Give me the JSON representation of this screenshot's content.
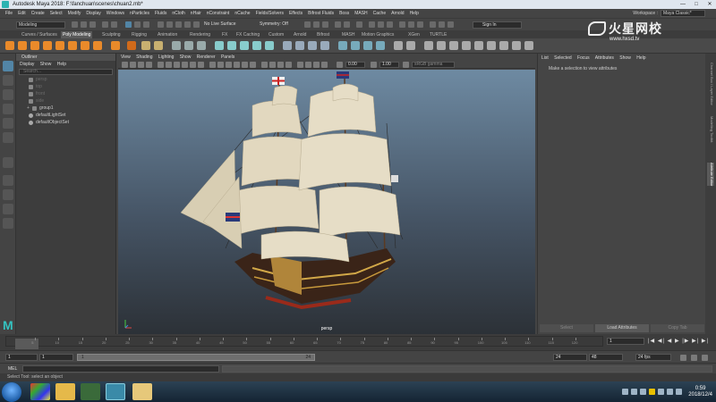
{
  "window": {
    "title": "Autodesk Maya 2018: F:\\fanchuan\\scenes\\chuan2.mb*",
    "controls": [
      "—",
      "□",
      "✕"
    ]
  },
  "menubar": {
    "items": [
      "File",
      "Edit",
      "Create",
      "Select",
      "Modify",
      "Display",
      "Windows",
      "nParticles",
      "Fluids",
      "nCloth",
      "nHair",
      "nConstraint",
      "nCache",
      "Fields/Solvers",
      "Effects",
      "Bifrost Fluids",
      "Boss",
      "MASH",
      "Cache",
      "Arnold",
      "Help"
    ],
    "workspace_label": "Workspace :",
    "workspace_value": "Maya Classic*"
  },
  "statusline": {
    "mode": "Modeling",
    "live_surface": "No Live Surface",
    "symmetry": "Symmetry: Off",
    "sign_in": "Sign In"
  },
  "shelf": {
    "tabs": [
      "Curves / Surfaces",
      "Poly Modeling",
      "Sculpting",
      "Rigging",
      "Animation",
      "Rendering",
      "FX",
      "FX Caching",
      "Custom",
      "Arnold",
      "Bifrost",
      "MASH",
      "Motion Graphics",
      "XGen",
      "TURTLE"
    ],
    "active_tab": "Poly Modeling"
  },
  "outliner": {
    "title": "Outliner",
    "menus": [
      "Display",
      "Show",
      "Help"
    ],
    "search_placeholder": "Search...",
    "items": [
      {
        "label": "persp",
        "dim": true
      },
      {
        "label": "top",
        "dim": true
      },
      {
        "label": "front",
        "dim": true
      },
      {
        "label": "side",
        "dim": true
      },
      {
        "label": "group1",
        "dim": false
      },
      {
        "label": "defaultLightSet",
        "dim": false
      },
      {
        "label": "defaultObjectSet",
        "dim": false
      }
    ]
  },
  "viewport": {
    "menus": [
      "View",
      "Shading",
      "Lighting",
      "Show",
      "Renderer",
      "Panels"
    ],
    "field_a": "0.00",
    "field_b": "1.00",
    "color_space": "sRGB gamma",
    "camera_label": "persp"
  },
  "attribute_editor": {
    "menus": [
      "List",
      "Selected",
      "Focus",
      "Attributes",
      "Show",
      "Help"
    ],
    "message": "Make a selection to view attributes",
    "buttons": [
      "Select",
      "Load Attributes",
      "Copy Tab"
    ],
    "side_tabs": [
      "Channel Box / Layer Editor",
      "Modelling Toolkit",
      "Attribute Editor"
    ]
  },
  "timeslider": {
    "tick_labels": [
      "5",
      "10",
      "15",
      "20",
      "25",
      "30",
      "35",
      "40",
      "45",
      "50",
      "55",
      "60",
      "65",
      "70",
      "75",
      "80",
      "85",
      "90",
      "95",
      "100",
      "105",
      "110",
      "115",
      "120"
    ],
    "current_frame": "1",
    "playback": "|◀ ◀| ◀ ▶ |▶ ▶| ▶|"
  },
  "rangeslider": {
    "start": "1",
    "inner_start": "1",
    "range_start": "1",
    "range_end": "24",
    "end": "24",
    "outer_end": "48",
    "fps": "24 fps"
  },
  "cmdline": {
    "label": "MEL"
  },
  "helpline": {
    "text": "Select Tool: select an object"
  },
  "taskbar": {
    "time": "0:59",
    "date": "2018/12/4"
  },
  "watermark": {
    "cn": "火星网校",
    "url": "www.hxsd.tv"
  },
  "colors": {
    "maya_teal": "#34c3c1",
    "active_tool": "#5285a6",
    "viewport_top": "#6e8aa2",
    "viewport_bottom": "#2c3137"
  }
}
